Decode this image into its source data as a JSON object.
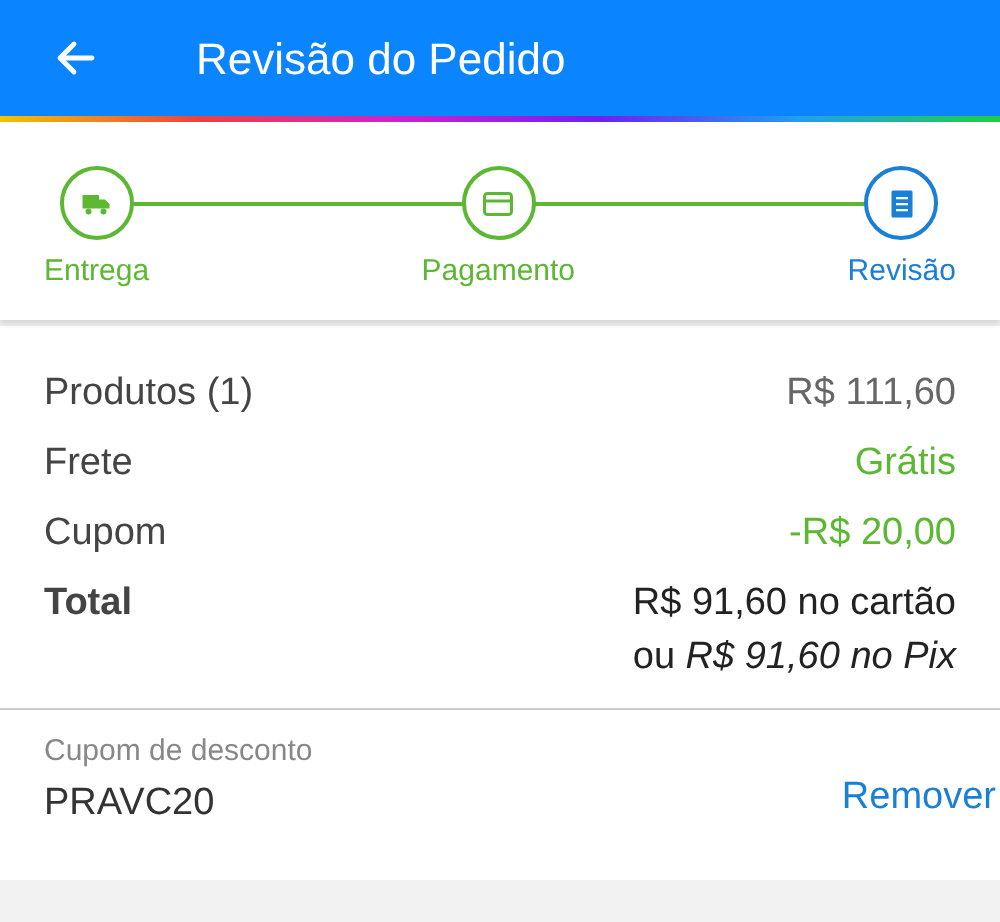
{
  "header": {
    "title": "Revisão do Pedido"
  },
  "steps": [
    {
      "label": "Entrega",
      "kind": "truck",
      "selected": false
    },
    {
      "label": "Pagamento",
      "kind": "card",
      "selected": false
    },
    {
      "label": "Revisão",
      "kind": "receipt",
      "selected": true
    }
  ],
  "summary": [
    {
      "kind": "line",
      "label": "Produtos (1)",
      "value": "R$ 111,60",
      "highlighted": false
    },
    {
      "kind": "line",
      "label": "Frete",
      "value": "Grátis",
      "highlighted": true
    },
    {
      "kind": "line",
      "label": "Cupom",
      "value": "-R$ 20,00",
      "highlighted": true
    },
    {
      "kind": "total",
      "label": "Total",
      "value": "R$ 91,60 no cartão",
      "note": "ou *R$ 91,60 no Pix*"
    }
  ],
  "coupon": {
    "label": "Cupom de desconto",
    "code": "PRAVC20",
    "action": "Remover"
  }
}
